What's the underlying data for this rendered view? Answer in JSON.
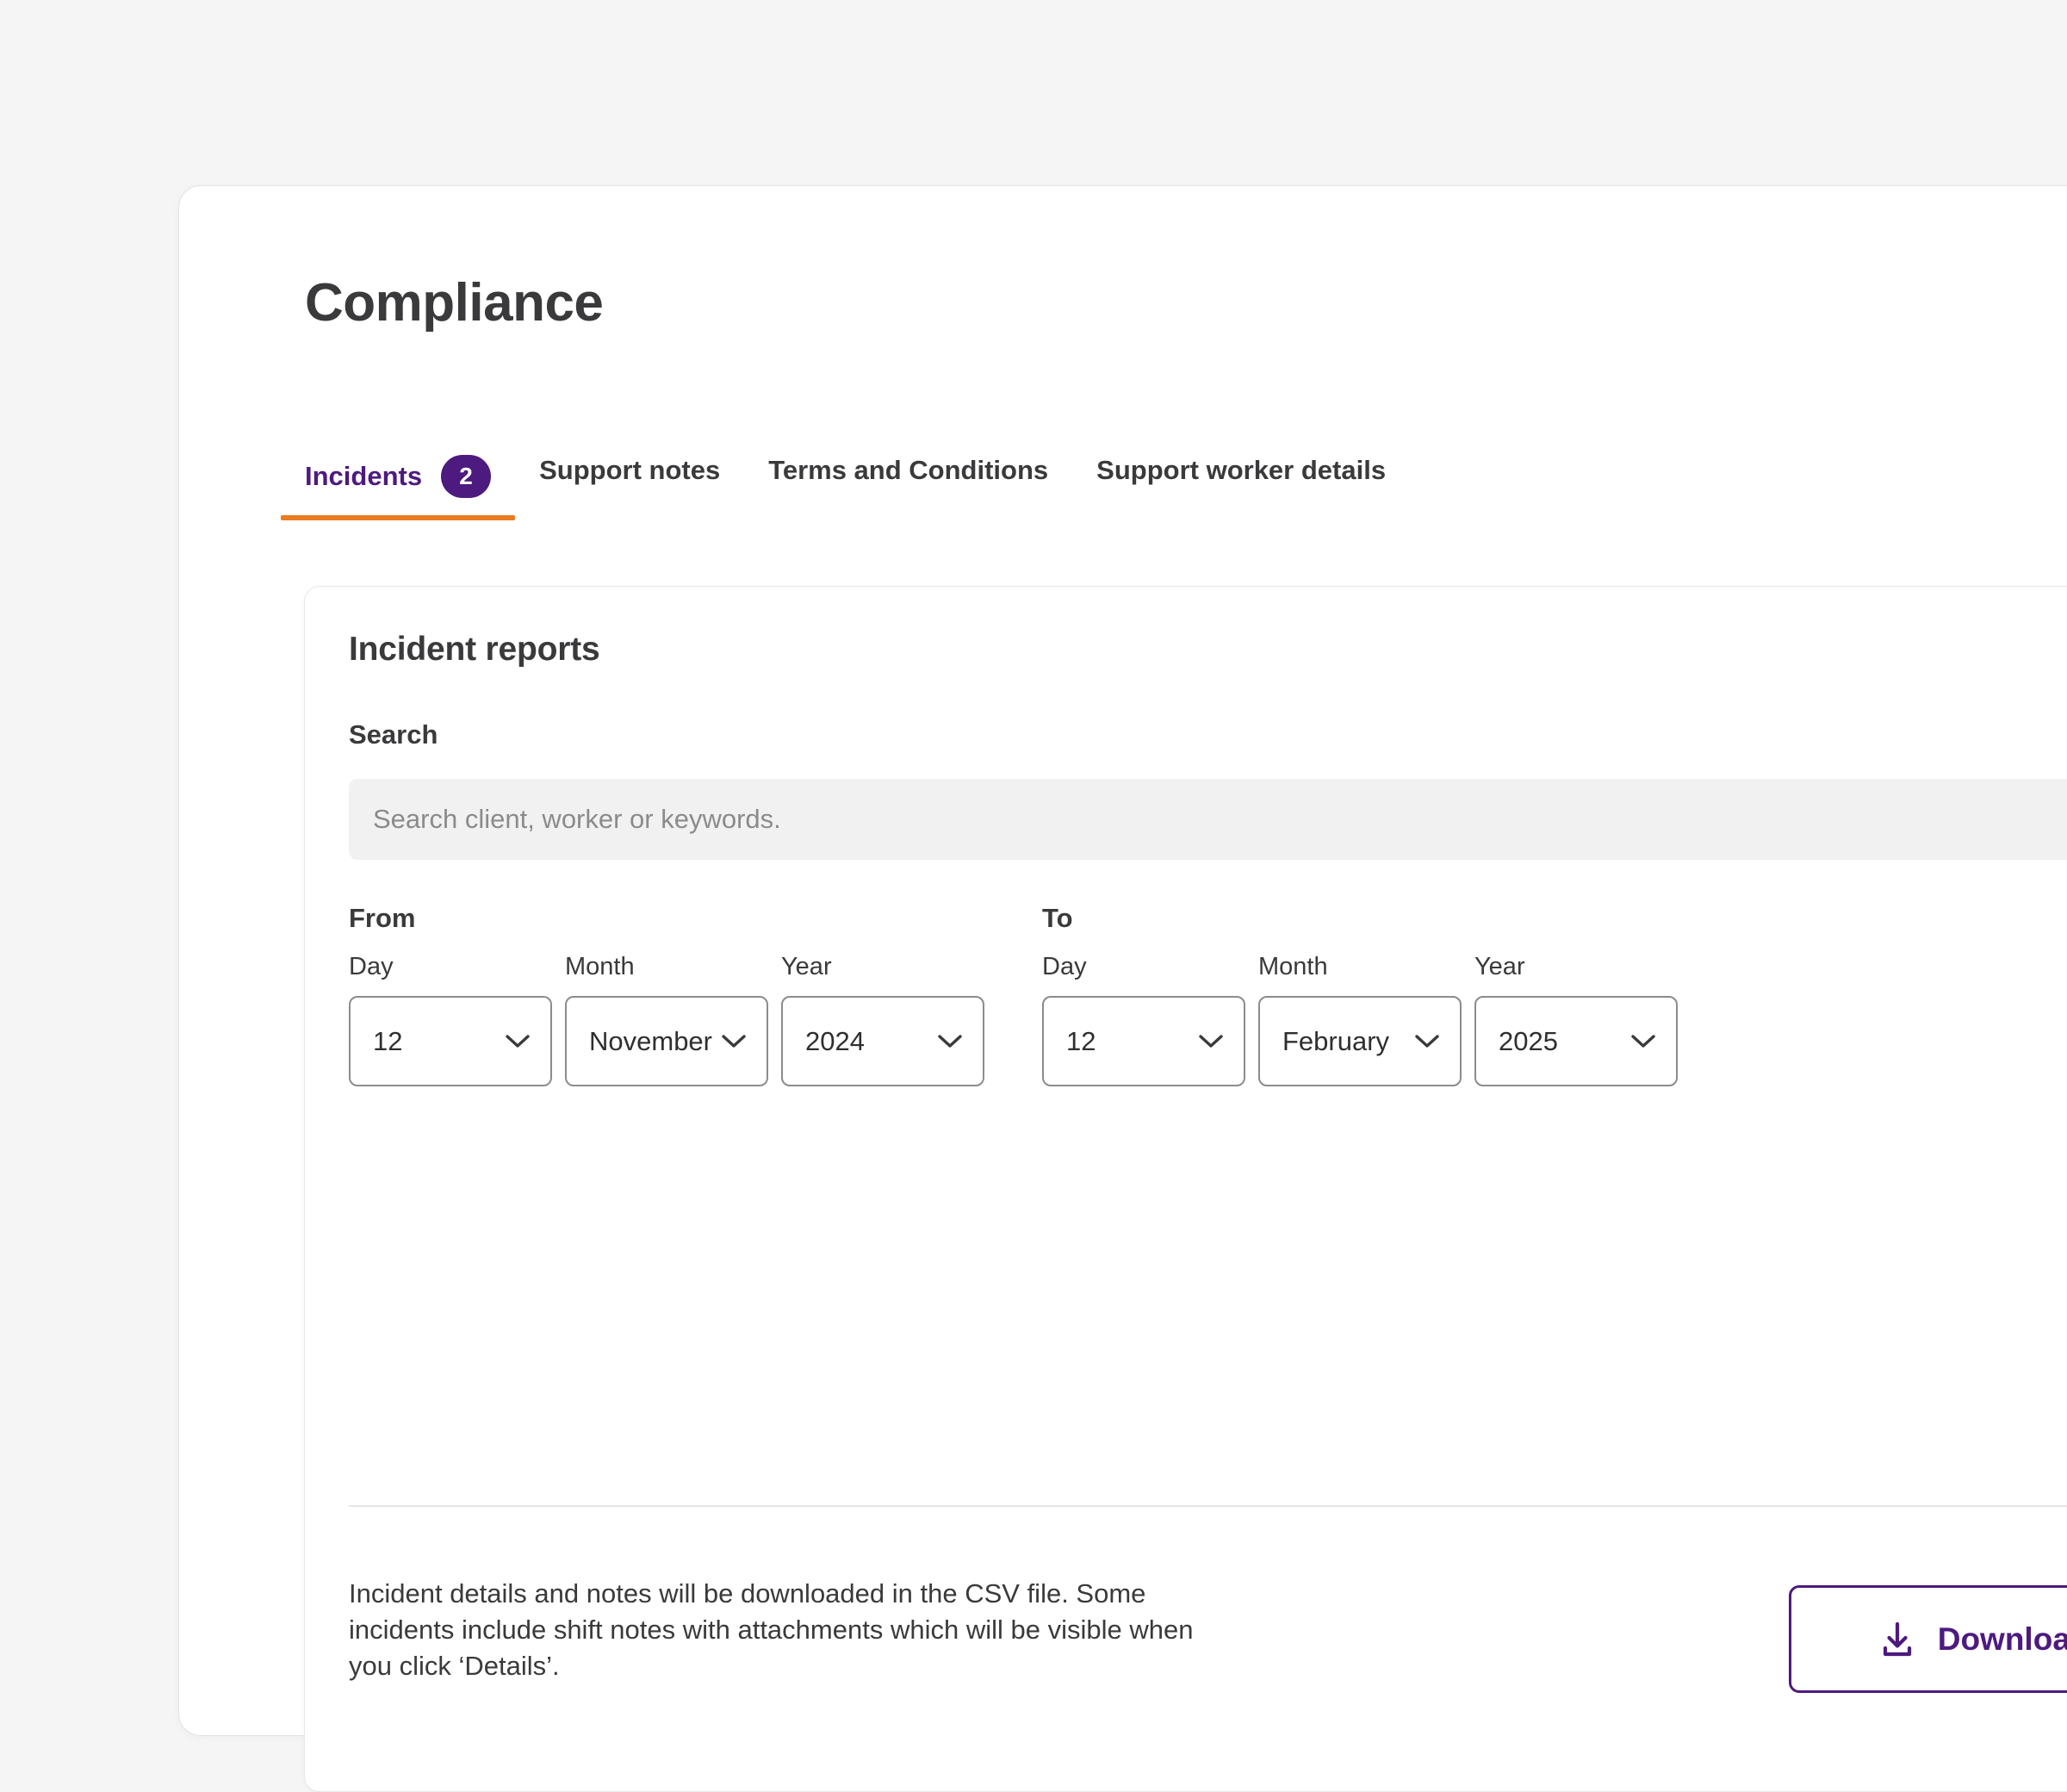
{
  "page": {
    "title": "Compliance",
    "background_color": "#f5f5f5",
    "accent_purple": "#4d1a80",
    "accent_orange": "#ea7b21"
  },
  "tabs": [
    {
      "label": "Incidents",
      "badge": "2",
      "active": true
    },
    {
      "label": "Support notes",
      "badge": null,
      "active": false
    },
    {
      "label": "Terms and Conditions",
      "badge": null,
      "active": false
    },
    {
      "label": "Support worker details",
      "badge": null,
      "active": false
    }
  ],
  "panel": {
    "title": "Incident reports",
    "search": {
      "label": "Search",
      "value": "",
      "placeholder": "Search client, worker or keywords."
    },
    "date_range": {
      "from": {
        "heading": "From",
        "fields": [
          {
            "label": "Day",
            "value": "12"
          },
          {
            "label": "Month",
            "value": "November"
          },
          {
            "label": "Year",
            "value": "2024"
          }
        ]
      },
      "to": {
        "heading": "To",
        "fields": [
          {
            "label": "Day",
            "value": "12"
          },
          {
            "label": "Month",
            "value": "February"
          },
          {
            "label": "Year",
            "value": "2025"
          }
        ]
      }
    },
    "footer": {
      "note": "Incident details and notes will be downloaded in the CSV file. Some incidents include shift notes with attachments which will be visible when you click ‘Details’.",
      "download_label": "Download reports",
      "download_icon": "download-icon"
    }
  }
}
